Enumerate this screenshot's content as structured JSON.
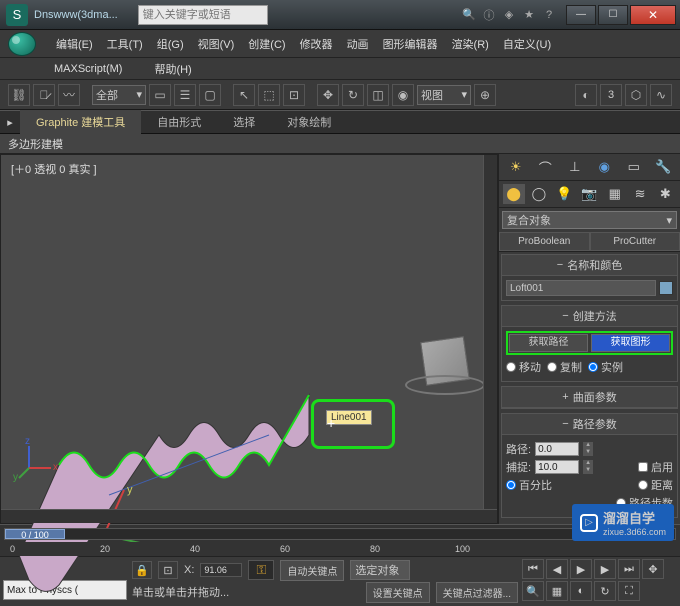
{
  "title": "Dnswww(3dma...",
  "search_placeholder": "键入关键字或短语",
  "menubar": [
    "编辑(E)",
    "工具(T)",
    "组(G)",
    "视图(V)",
    "创建(C)",
    "修改器",
    "动画",
    "图形编辑器",
    "渲染(R)",
    "自定义(U)"
  ],
  "menubar2": [
    "MAXScript(M)",
    "帮助(H)"
  ],
  "toolbar": {
    "scope": "全部",
    "view": "视图",
    "digit": "3"
  },
  "ribbon": {
    "tabs": [
      "Graphite 建模工具",
      "自由形式",
      "选择",
      "对象绘制"
    ],
    "panel": "多边形建模"
  },
  "viewport": {
    "label": "[＋0 透视 0 真实 ]",
    "tooltip": "Line001",
    "axes": {
      "x": "x",
      "y": "y",
      "z": "z"
    }
  },
  "timeline": {
    "pos": "0 / 100",
    "ticks": [
      "0",
      "20",
      "40",
      "60",
      "80",
      "100"
    ]
  },
  "side": {
    "category": "复合对象",
    "subtabs": [
      "ProBoolean",
      "ProCutter"
    ],
    "name_roll": "名称和颜色",
    "obj_name": "Loft001",
    "method_roll": "创建方法",
    "get_path": "获取路径",
    "get_shape": "获取图形",
    "radios1": [
      "移动",
      "复制",
      "实例"
    ],
    "surf_roll": "曲面参数",
    "path_roll": "路径参数",
    "path_label": "路径:",
    "path_val": "0.0",
    "snap_label": "捕捉:",
    "snap_val": "10.0",
    "enable": "启用",
    "radios2": [
      "百分比",
      "距离"
    ],
    "path_steps": "路径步数"
  },
  "bottom": {
    "script": "Max to Physcs (",
    "hint1": "单击或单击并拖动...",
    "hint2": "设置关键点",
    "hint3": "关键点过滤器...",
    "x": "X:",
    "xv": "91.06",
    "autokey": "自动关键点",
    "selobj": "选定对象"
  },
  "watermark": {
    "brand": "溜溜自学",
    "url": "zixue.3d66.com"
  }
}
